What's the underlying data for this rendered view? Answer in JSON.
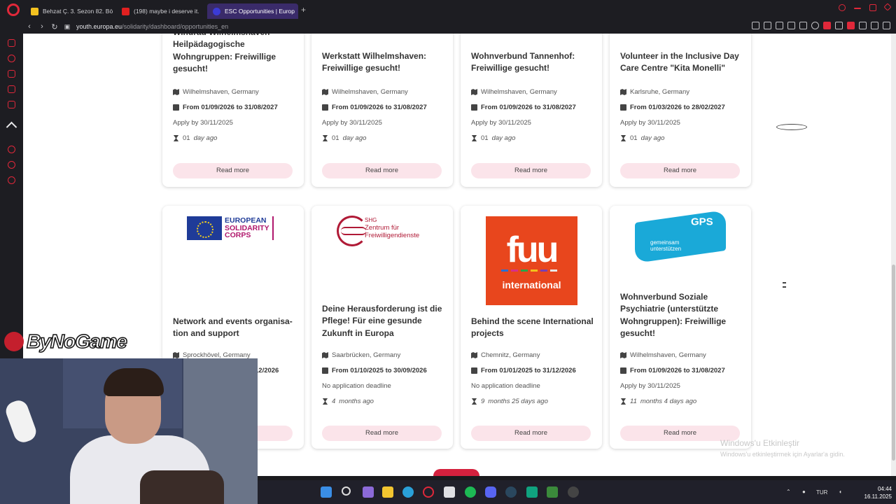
{
  "browser": {
    "tabs": [
      {
        "label": "Behzat Ç. 3. Sezon 82. Bö",
        "color": "#f3c220",
        "active": false
      },
      {
        "label": "(198) maybe i deserve it.",
        "color": "#e02020",
        "active": false
      },
      {
        "label": "ESC Opportunities | Europ",
        "color": "#3b3bd6",
        "active": true
      }
    ],
    "url_host": "youth.europa.eu",
    "url_path": "/solidarity/dashboard/opportunities_en"
  },
  "cards_row1": [
    {
      "title": "Windrad Wilhelmshaven – Heilpädagogische Wohngruppen: Freiwillige gesucht!",
      "location": "Wilhelmshaven, Germany",
      "dates": "From 01/09/2026 to 31/08/2027",
      "apply": "Apply by 30/11/2025",
      "posted_num": "01",
      "posted_unit": "day ago",
      "read_more": "Read more"
    },
    {
      "title": "Werkstatt Wilhelmshaven: Freiwillige gesucht!",
      "location": "Wilhelmshaven, Germany",
      "dates": "From 01/09/2026 to 31/08/2027",
      "apply": "Apply by 30/11/2025",
      "posted_num": "01",
      "posted_unit": "day ago",
      "read_more": "Read more"
    },
    {
      "title": "Wohnverbund Tannenhof: Freiwillige gesucht!",
      "location": "Wilhelmshaven, Germany",
      "dates": "From 01/09/2026 to 31/08/2027",
      "apply": "Apply by 30/11/2025",
      "posted_num": "01",
      "posted_unit": "day ago",
      "read_more": "Read more"
    },
    {
      "title": "Volunteer in the Inclusive Day Care Centre \"Kita Monelli\"",
      "location": "Karlsruhe, Germany",
      "dates": "From 01/03/2026 to 28/02/2027",
      "apply": "Apply by 30/11/2025",
      "posted_num": "01",
      "posted_unit": "day ago",
      "read_more": "Read more"
    }
  ],
  "cards_row2": [
    {
      "title": "Network and events organisa-tion and support",
      "location": "Sprockhövel, Germany",
      "dates": "12/2026",
      "read_more": "Read more",
      "logo": {
        "l1": "EUROPEAN",
        "l2": "SOLIDARITY",
        "l3": "CORPS"
      }
    },
    {
      "title": "Deine Herausforderung ist die Pflege! Für eine gesunde Zukunft in Europa",
      "location": "Saarbrücken, Germany",
      "dates": "From 01/10/2025 to 30/09/2026",
      "apply": "No application deadline",
      "posted_num": "4",
      "posted_unit": "months ago",
      "read_more": "Read more",
      "logo": {
        "l1": "SHG",
        "l2": "Zentrum für",
        "l3": "Freiwilligendienste"
      }
    },
    {
      "title": "Behind the scene International projects",
      "location": "Chemnitz, Germany",
      "dates": "From 01/01/2025 to 31/12/2026",
      "apply": "No application deadline",
      "posted_num": "9",
      "posted_unit": "months 25 days ago",
      "read_more": "Read more",
      "logo": {
        "l1": "fuu",
        "l2": "international"
      }
    },
    {
      "title": "Wohnverbund Soziale Psychiatrie (unterstützte Wohngruppen): Freiwillige gesucht!",
      "location": "Wilhelmshaven, Germany",
      "dates": "From 01/09/2026 to 31/08/2027",
      "apply": "Apply by 30/11/2025",
      "posted_num": "11",
      "posted_unit": "months 4 days ago",
      "read_more": "Read more",
      "logo": {
        "l1": "GPS",
        "l2": "gemeinsam",
        "l3": "unterstützen"
      }
    }
  ],
  "watermark": {
    "line1": "Windows'u Etkinleştir",
    "line2": "Windows'u etkinleştirmek için Ayarlar'a gidin."
  },
  "overlay": {
    "brand": "ByNoGame"
  },
  "taskbar": {
    "lang": "TUR",
    "time": "04:44",
    "date": "16.11.2025"
  }
}
